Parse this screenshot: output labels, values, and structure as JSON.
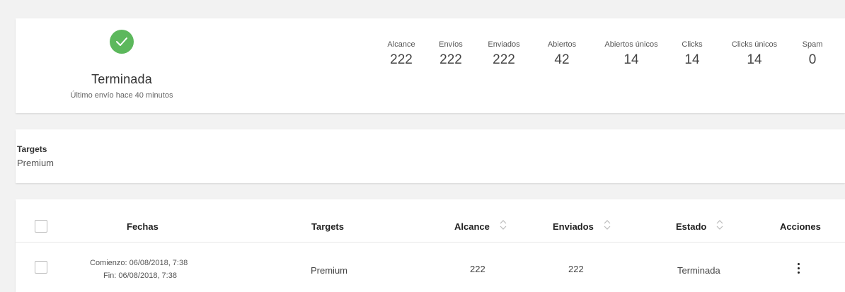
{
  "summary": {
    "status_title": "Terminada",
    "status_subtitle": "Último envío hace 40 minutos",
    "status_color": "#5cb85c",
    "stats": [
      {
        "label": "Alcance",
        "value": "222"
      },
      {
        "label": "Envíos",
        "value": "222"
      },
      {
        "label": "Enviados",
        "value": "222"
      },
      {
        "label": "Abiertos",
        "value": "42"
      },
      {
        "label": "Abiertos únicos",
        "value": "14"
      },
      {
        "label": "Clicks",
        "value": "14"
      },
      {
        "label": "Clicks únicos",
        "value": "14"
      },
      {
        "label": "Spam",
        "value": "0"
      }
    ]
  },
  "targets": {
    "label": "Targets",
    "value": "Premium"
  },
  "table": {
    "headers": {
      "fechas": "Fechas",
      "targets": "Targets",
      "alcance": "Alcance",
      "enviados": "Enviados",
      "estado": "Estado",
      "acciones": "Acciones"
    },
    "rows": [
      {
        "start": "Comienzo: 06/08/2018, 7:38",
        "end": "Fin: 06/08/2018, 7:38",
        "targets": "Premium",
        "alcance": "222",
        "enviados": "222",
        "estado": "Terminada"
      }
    ]
  }
}
